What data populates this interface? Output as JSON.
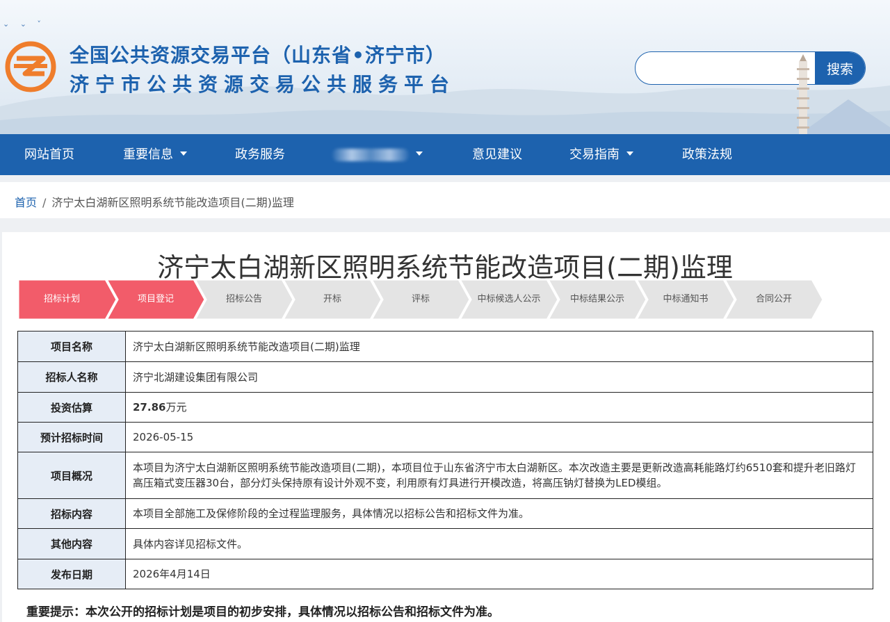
{
  "header": {
    "title_line1": "全国公共资源交易平台（山东省•济宁市）",
    "title_line2": "济宁市公共资源交易公共服务平台",
    "search": {
      "placeholder": "",
      "button_label": "搜索"
    },
    "colors": {
      "brand_blue": "#1d62ae",
      "logo_orange": "#ef7d2c"
    }
  },
  "nav": {
    "items": [
      {
        "label": "网站首页",
        "dropdown": false
      },
      {
        "label": "重要信息",
        "dropdown": true
      },
      {
        "label": "政务服务",
        "dropdown": false
      },
      {
        "label": "",
        "dropdown": true,
        "obscured": true
      },
      {
        "label": "意见建议",
        "dropdown": false
      },
      {
        "label": "交易指南",
        "dropdown": true
      },
      {
        "label": "政策法规",
        "dropdown": false
      }
    ]
  },
  "breadcrumb": {
    "home": "首页",
    "separator": "/",
    "current": "济宁太白湖新区照明系统节能改造项目(二期)监理"
  },
  "page_title": "济宁太白湖新区照明系统节能改造项目(二期)监理",
  "steps": {
    "active_color": "#f25c6a",
    "inactive_color": "#e4e4e4",
    "items": [
      {
        "label": "招标计划",
        "active": true
      },
      {
        "label": "项目登记",
        "active": true
      },
      {
        "label": "招标公告",
        "active": false
      },
      {
        "label": "开标",
        "active": false
      },
      {
        "label": "评标",
        "active": false
      },
      {
        "label": "中标候选人公示",
        "active": false
      },
      {
        "label": "中标结果公示",
        "active": false
      },
      {
        "label": "中标通知书",
        "active": false
      },
      {
        "label": "合同公开",
        "active": false
      }
    ]
  },
  "details": {
    "project_name": {
      "label": "项目名称",
      "value": "济宁太白湖新区照明系统节能改造项目(二期)监理"
    },
    "tenderer": {
      "label": "招标人名称",
      "value": "济宁北湖建设集团有限公司"
    },
    "investment": {
      "label": "投资估算",
      "amount": "27.86",
      "unit": "万元"
    },
    "planned_date": {
      "label": "预计招标时间",
      "value": "2026-05-15"
    },
    "overview": {
      "label": "项目概况",
      "value": "本项目为济宁太白湖新区照明系统节能改造项目(二期)，本项目位于山东省济宁市太白湖新区。本次改造主要是更新改造高耗能路灯约6510套和提升老旧路灯高压箱式变压器30台，部分灯头保持原有设计外观不变，利用原有灯具进行开模改造，将高压钠灯替换为LED模组。"
    },
    "content": {
      "label": "招标内容",
      "value": "本项目全部施工及保修阶段的全过程监理服务，具体情况以招标公告和招标文件为准。"
    },
    "other": {
      "label": "其他内容",
      "value": "具体内容详见招标文件。"
    },
    "publish_date": {
      "label": "发布日期",
      "value": "2026年4月14日"
    }
  },
  "notice": "重要提示：本次公开的招标计划是项目的初步安排，具体情况以招标公告和招标文件为准。"
}
